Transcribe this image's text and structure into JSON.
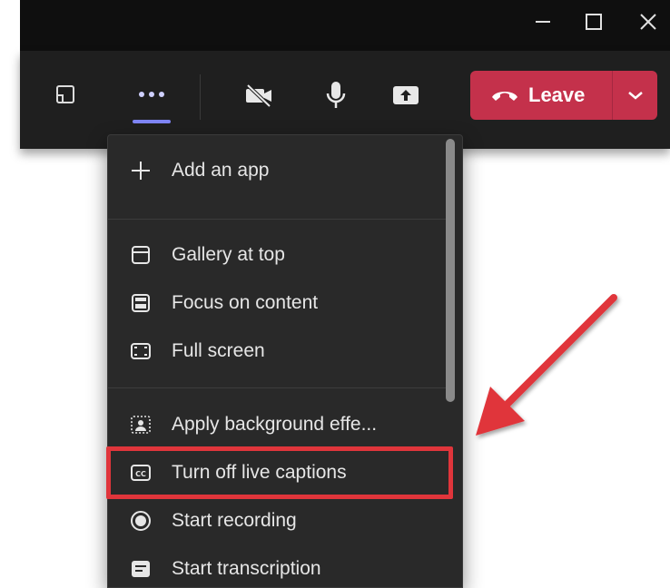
{
  "window": {
    "controls": [
      "minimize",
      "maximize",
      "close"
    ]
  },
  "toolbar": {
    "leave_label": "Leave",
    "accent_color": "#7f85f5",
    "leave_color": "#c4314b"
  },
  "menu": {
    "items": [
      {
        "label": "Add an app",
        "icon": "plus-icon"
      },
      {
        "label": "Gallery at top",
        "icon": "gallery-icon"
      },
      {
        "label": "Focus on content",
        "icon": "focus-icon"
      },
      {
        "label": "Full screen",
        "icon": "fullscreen-icon"
      },
      {
        "label": "Apply background effe...",
        "icon": "background-effects-icon"
      },
      {
        "label": "Turn off live captions",
        "icon": "cc-icon"
      },
      {
        "label": "Start recording",
        "icon": "record-icon"
      },
      {
        "label": "Start transcription",
        "icon": "transcription-icon"
      }
    ]
  },
  "annotation": {
    "highlight_color": "#e0353b",
    "highlighted_item": "Turn off live captions"
  }
}
